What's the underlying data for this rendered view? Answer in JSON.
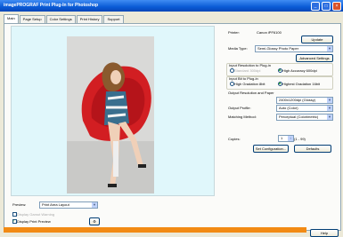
{
  "window": {
    "title": "imagePROGRAF Print Plug-In for Photoshop",
    "minimize": "_",
    "maximize": "□",
    "close": "×"
  },
  "tabs": [
    "Main",
    "Page Setup",
    "Color Settings",
    "Print History",
    "Support"
  ],
  "right": {
    "printer_label": "Printer:",
    "printer_value": "Canon iPF6100",
    "update_button": "Update",
    "media_type_label": "Media Type:",
    "media_type_value": "Semi-Glossy Photo Paper",
    "advanced_button": "Advanced Settings",
    "input_resolution_label": "Input Resolution to Plug-in",
    "input_res_opt1": "Standard 300dpi",
    "input_res_opt2": "High Accuracy 600dpi",
    "input_bit_label": "Input Bit to Plug-in",
    "input_bit_opt1": "High Gradation 8bit",
    "input_bit_opt2": "Highest Gradation 16bit",
    "output_profile_group_label": "Output Resolution and Paper",
    "output_res_value": "2400x1200dpi (Glossy)",
    "output_profile_label": "Output Profile:",
    "output_profile_value": "Auto (Color)",
    "matching_label": "Matching Method:",
    "matching_value": "Perceptual (Colorimetric)",
    "copies_label": "Copies:",
    "copies_value": "1",
    "copies_range": "(1 - 99)",
    "set_config_button": "Set Configuration...",
    "defaults_button": "Defaults"
  },
  "bottom": {
    "preview_label": "Preview:",
    "preview_value": "Print Area Layout",
    "check1": "Display Gamut Warning",
    "check2": "Display Print Preview",
    "help_button": "Help"
  },
  "colors": {
    "title_bar": "#0a5bd6",
    "preview_bg": "#e0f7fb",
    "accent_bar": "#f28a14",
    "chair_red": "#d21e22"
  }
}
